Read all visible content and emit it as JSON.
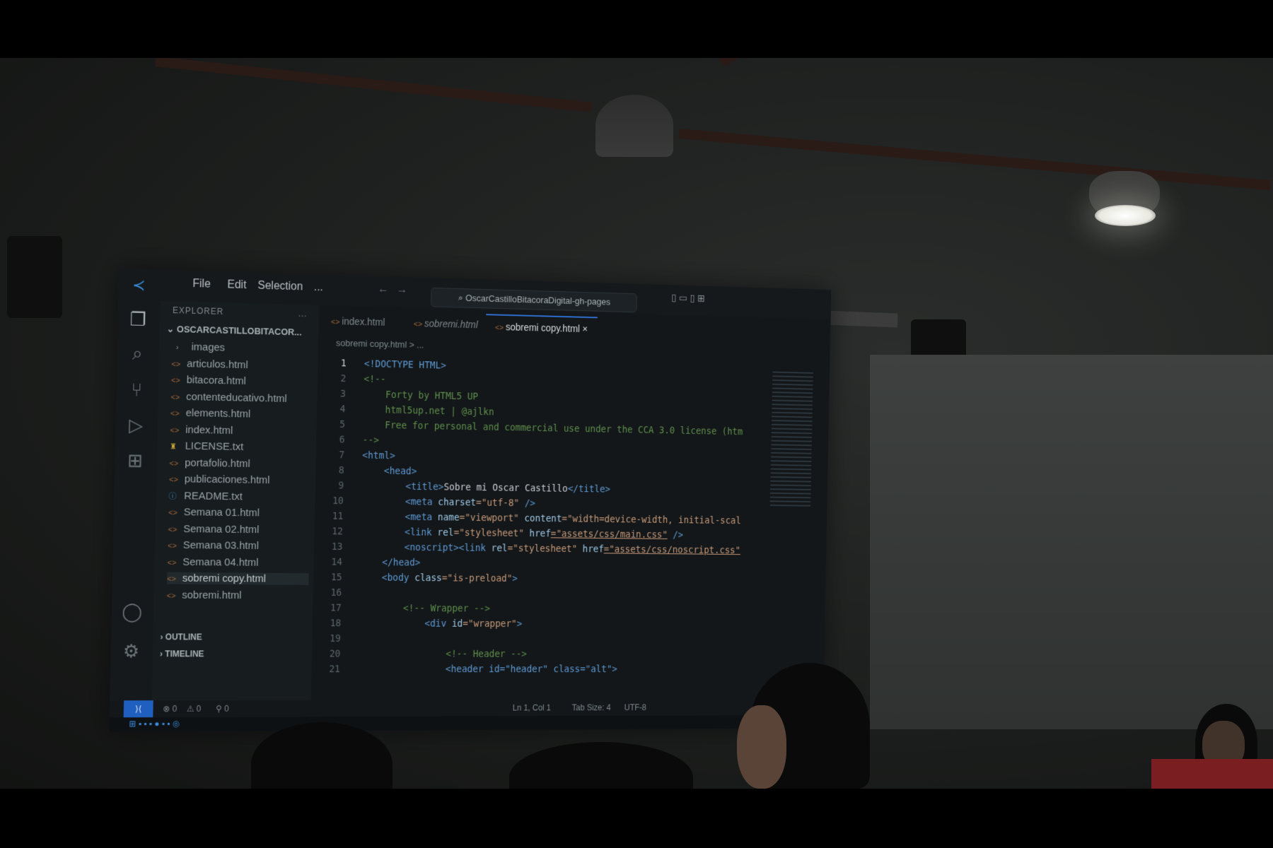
{
  "vscode": {
    "menu": {
      "file": "File",
      "edit": "Edit",
      "selection": "Selection",
      "more": "..."
    },
    "search": "OscarCastilloBitacoraDigital-gh-pages",
    "explorer": {
      "header": "EXPLORER",
      "more": "...",
      "project": "OSCARCASTILLOBITACOR...",
      "items": [
        {
          "label": "images",
          "type": "folder"
        },
        {
          "label": "articulos.html",
          "type": "html"
        },
        {
          "label": "bitacora.html",
          "type": "html"
        },
        {
          "label": "contenteducativo.html",
          "type": "html"
        },
        {
          "label": "elements.html",
          "type": "html"
        },
        {
          "label": "index.html",
          "type": "html"
        },
        {
          "label": "LICENSE.txt",
          "type": "license"
        },
        {
          "label": "portafolio.html",
          "type": "html"
        },
        {
          "label": "publicaciones.html",
          "type": "html"
        },
        {
          "label": "README.txt",
          "type": "info"
        },
        {
          "label": "Semana 01.html",
          "type": "html"
        },
        {
          "label": "Semana 02.html",
          "type": "html"
        },
        {
          "label": "Semana 03.html",
          "type": "html"
        },
        {
          "label": "Semana 04.html",
          "type": "html"
        },
        {
          "label": "sobremi copy.html",
          "type": "html",
          "active": true
        },
        {
          "label": "sobremi.html",
          "type": "html"
        }
      ],
      "outline": "OUTLINE",
      "timeline": "TIMELINE"
    },
    "tabs": [
      {
        "label": "index.html"
      },
      {
        "label": "sobremi.html"
      },
      {
        "label": "sobremi copy.html",
        "active": true,
        "close": "×"
      }
    ],
    "breadcrumb": "sobremi copy.html > ...",
    "code_lines": [
      {
        "n": "1"
      },
      {
        "n": "2"
      },
      {
        "n": "3"
      },
      {
        "n": "4"
      },
      {
        "n": "5"
      },
      {
        "n": "6"
      },
      {
        "n": "7"
      },
      {
        "n": "8"
      },
      {
        "n": "9"
      },
      {
        "n": "10"
      },
      {
        "n": "11"
      },
      {
        "n": "12"
      },
      {
        "n": "13"
      },
      {
        "n": "14"
      },
      {
        "n": "15"
      },
      {
        "n": "16"
      },
      {
        "n": "17"
      },
      {
        "n": "18"
      },
      {
        "n": "19"
      },
      {
        "n": "20"
      },
      {
        "n": "21"
      }
    ],
    "code": {
      "l1": "<!DOCTYPE HTML>",
      "l2": "<!--",
      "l3": "Forty by HTML5 UP",
      "l4": "html5up.net | @ajlkn",
      "l5": "Free for personal and commercial use under the CCA 3.0 license (htm",
      "l6": "-->",
      "l7": "<html>",
      "l8": "<head>",
      "l9a": "<title>",
      "l9b": "Sobre mi Oscar Castillo",
      "l9c": "</title>",
      "l10a": "<meta ",
      "l10b": "charset",
      "l10c": "=\"utf-8\"",
      "l10d": " />",
      "l11a": "<meta ",
      "l11b": "name",
      "l11c": "=\"viewport\" ",
      "l11d": "content",
      "l11e": "=\"width=device-width, initial-scal",
      "l12a": "<link ",
      "l12b": "rel",
      "l12c": "=\"stylesheet\" ",
      "l12d": "href",
      "l12e": "=\"assets/css/main.css\"",
      "l12f": " />",
      "l13a": "<noscript><link ",
      "l13b": "rel",
      "l13c": "=\"stylesheet\" ",
      "l13d": "href",
      "l13e": "=\"assets/css/noscript.css\"",
      "l14": "</head>",
      "l15a": "<body ",
      "l15b": "class",
      "l15c": "=\"is-preload\"",
      "l15d": ">",
      "l17": "<!-- Wrapper -->",
      "l18a": "<div ",
      "l18b": "id",
      "l18c": "=\"wrapper\"",
      "l18d": ">",
      "l20": "<!-- Header -->",
      "l21": "<header id=\"header\" class=\"alt\">"
    },
    "status": {
      "errors": "⊗ 0",
      "warnings": "⚠ 0",
      "ports": "0",
      "position": "Ln 1, Col 1",
      "tab_size": "Tab Size: 4",
      "encoding": "UTF-8"
    },
    "colors": {
      "accent": "#1f5fbf",
      "tag": "#5e9ad6",
      "string": "#c89a7a",
      "comment": "#5f8f4c"
    }
  }
}
